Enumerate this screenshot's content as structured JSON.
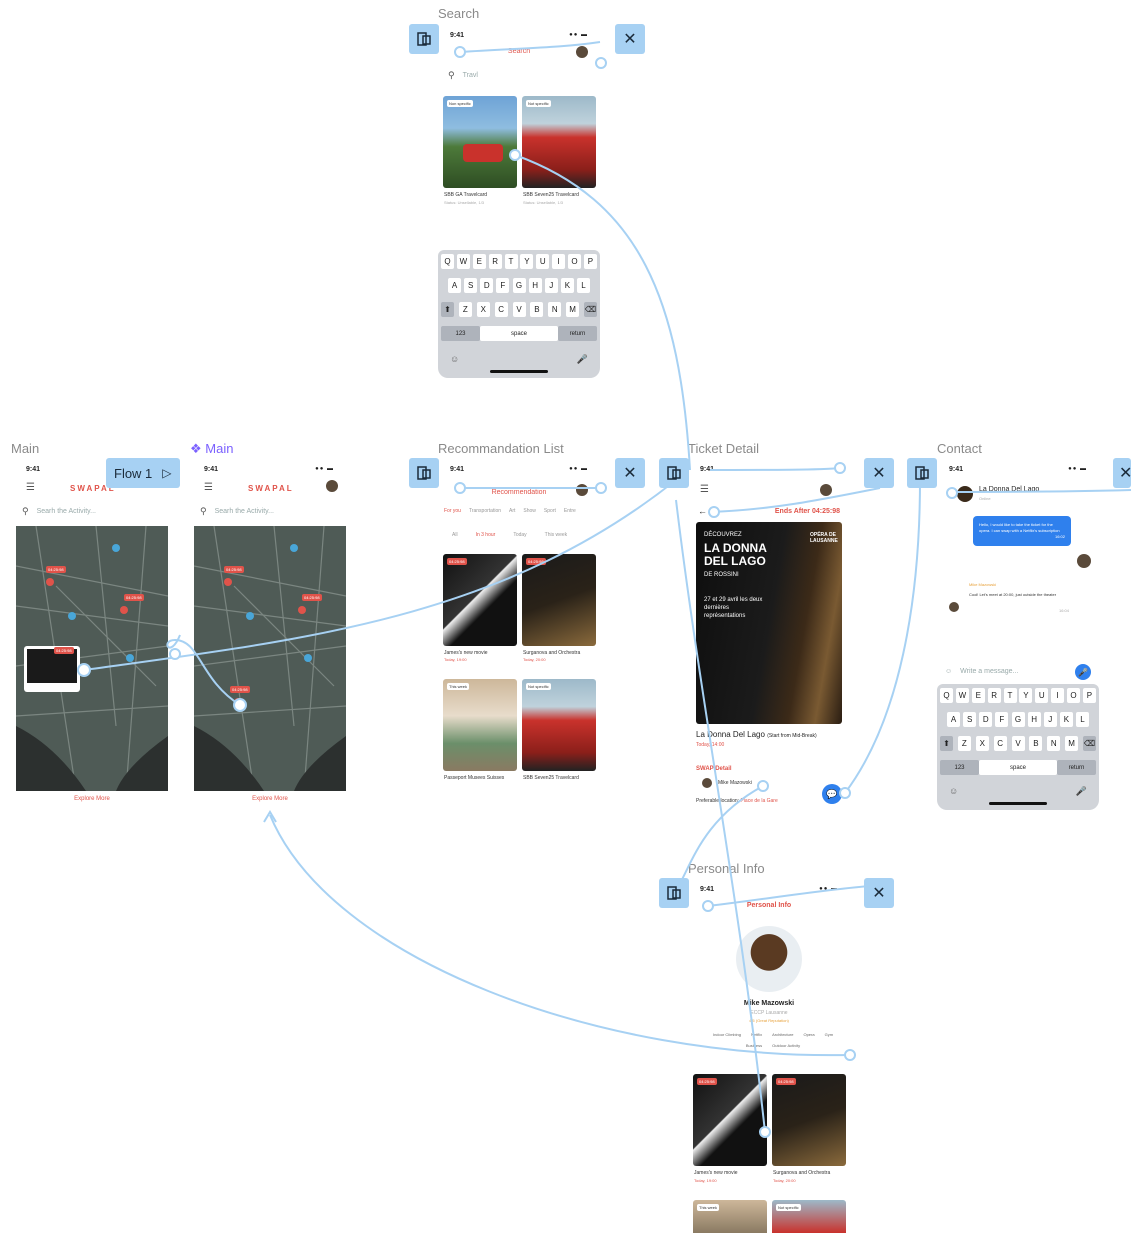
{
  "frames": {
    "search": "Search",
    "main": "Main",
    "main2": "Main",
    "recommendation": "Recommandation List",
    "ticket": "Ticket Detail",
    "contact": "Contact",
    "personal": "Personal Info"
  },
  "flow": {
    "label": "Flow 1"
  },
  "status_time": "9:41",
  "search_screen": {
    "title": "Search",
    "query": "Travl",
    "cards": [
      {
        "badge": "Non specific",
        "title": "SBB GA Travelcard",
        "sub": "Status: Unsellable, 1/3"
      },
      {
        "badge": "Not specific",
        "title": "SBB Seven25 Travelcard",
        "sub": "Status: Unsellable, 1/3"
      }
    ]
  },
  "keyboard": {
    "row1": [
      "Q",
      "W",
      "E",
      "R",
      "T",
      "Y",
      "U",
      "I",
      "O",
      "P"
    ],
    "row2": [
      "A",
      "S",
      "D",
      "F",
      "G",
      "H",
      "J",
      "K",
      "L"
    ],
    "row3": [
      "Z",
      "X",
      "C",
      "V",
      "B",
      "N",
      "M"
    ],
    "num": "123",
    "space": "space",
    "return": "return"
  },
  "main_screen": {
    "brand": "SWAPAL",
    "search_placeholder": "Searh the Activity...",
    "explore": "Explore More",
    "timer1": "04:25:98",
    "timer2": "04:25:98",
    "timer3": "04:25:98"
  },
  "recommendation_screen": {
    "title": "Recommendation",
    "tabs": [
      "For you",
      "Transportation",
      "Art",
      "Show",
      "Sport",
      "Entre"
    ],
    "filters": [
      "All",
      "In 3 hour",
      "Today",
      "This week"
    ],
    "cards": [
      {
        "badge": "04:25:98",
        "title": "James's new movie",
        "sub": "Today, 19:00"
      },
      {
        "badge": "04:25:98",
        "title": "Surganova and Orchestra",
        "sub": "Today, 20:00"
      },
      {
        "badge": "This week",
        "title": "Passeport Musees Suisses",
        "sub": ""
      },
      {
        "badge": "Not specific",
        "title": "SBB Seven25 Travelcard",
        "sub": ""
      }
    ]
  },
  "ticket_screen": {
    "ends_after": "Ends After 04:25:98",
    "poster_title": "LA DONNA DEL LAGO",
    "poster_sub": "DE ROSSINI",
    "poster_small": "DÉCOUVREZ",
    "poster_dates": "27 et 29 avril les deux dernières représentations",
    "poster_brand": "OPÉRA DE LAUSANNE",
    "event_title": "La Donna Del Lago",
    "event_note": "(Start from Mid-Break)",
    "event_time": "Today, 14:00",
    "swap_heading": "SWAP Detail",
    "swap_user": "Mike Mazowski",
    "swap_location": "Preferable location:",
    "swap_place": "Place de la Gare"
  },
  "contact_screen": {
    "name": "La Donna Del Lago",
    "status": "Online",
    "message1": "Hello, I would like to take the ticket for the opera. I can swap with a Netflix's subscription",
    "time1": "16:02",
    "sender2": "Mike Mazowski",
    "message2": "Cool! Let's meet at 20:00, just outside the theater",
    "time2": "16:04",
    "input_placeholder": "Write a message..."
  },
  "personal_screen": {
    "title": "Personal Info",
    "name": "Mike Mazowski",
    "school": "ECCP Lausanne",
    "rating": "4.5 (Great Reputation)",
    "tags": [
      "Indoor Climbing",
      "Netflix",
      "Architecture",
      "Opera",
      "Gym",
      "Business",
      "Outdoor Activity"
    ],
    "cards": [
      {
        "badge": "04:25:98",
        "title": "James's new movie",
        "sub": "Today, 19:00"
      },
      {
        "badge": "04:25:98",
        "title": "Surganova and Orchestra",
        "sub": "Today, 20:00"
      }
    ],
    "bottom_badges": [
      "This week",
      "Not specific"
    ]
  },
  "colors": {
    "accent": "#e0534a",
    "flow": "#a7d1f3",
    "map": "#4f5b56",
    "chat": "#2f80ed"
  }
}
